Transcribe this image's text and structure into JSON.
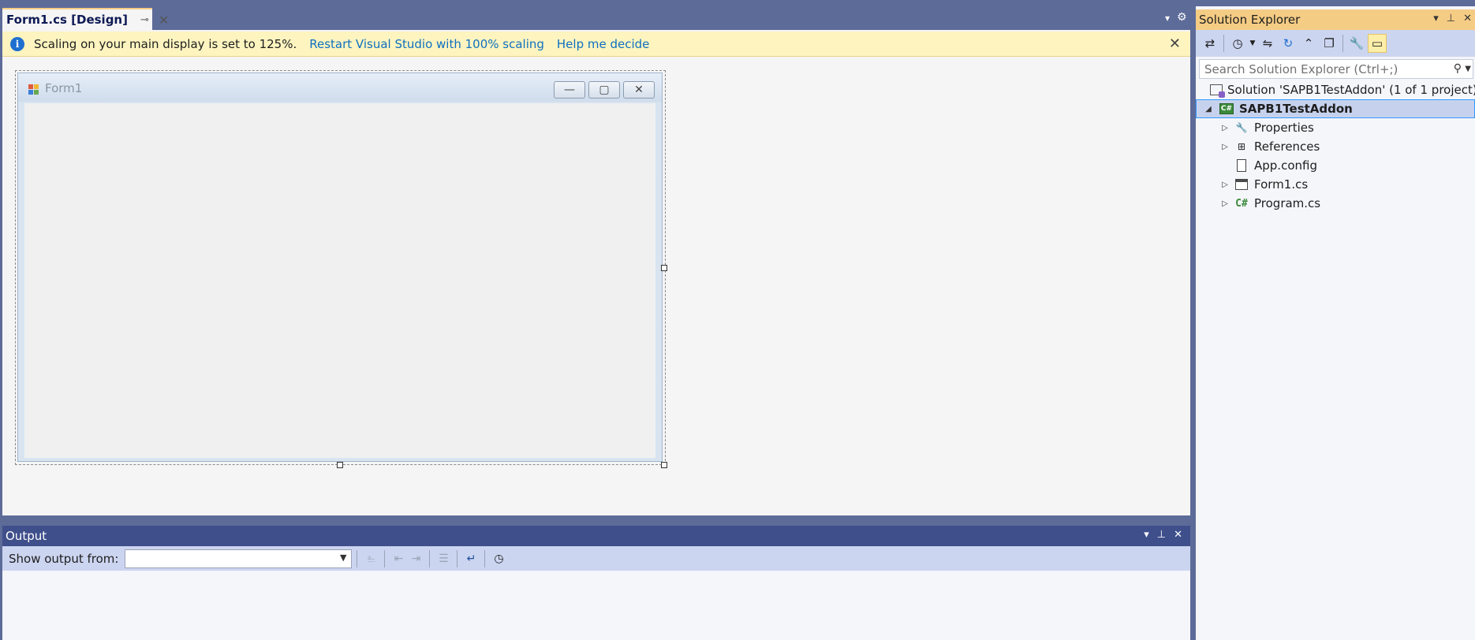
{
  "document": {
    "tab_title": "Form1.cs [Design]",
    "tab_pin_glyph": "⊸",
    "tab_close_glyph": "✕",
    "strip_dropdown_glyph": "▾",
    "strip_settings_glyph": "⚙"
  },
  "infobar": {
    "icon": "info-icon",
    "message": "Scaling on your main display is set to 125%.",
    "link_restart": "Restart Visual Studio with 100% scaling",
    "link_help": "Help me decide",
    "close_glyph": "✕"
  },
  "designer_form": {
    "title": "Form1",
    "minimize_glyph": "—",
    "maximize_glyph": "▢",
    "close_glyph": "✕"
  },
  "output": {
    "title": "Output",
    "show_output_from_label": "Show output from:",
    "selected_source": "",
    "header_icons": [
      "dropdown-icon",
      "pin-icon",
      "close-icon"
    ]
  },
  "solution_explorer": {
    "title": "Solution Explorer",
    "search_placeholder": "Search Solution Explorer (Ctrl+;)",
    "toolbar_icons": [
      "switch-views-icon",
      "pending-changes-icon",
      "sync-icon",
      "refresh-icon",
      "collapse-all-icon",
      "show-all-files-icon",
      "properties-icon",
      "preview-selected-icon"
    ],
    "tree": {
      "solution": "Solution 'SAPB1TestAddon' (1 of 1 project)",
      "project": "SAPB1TestAddon",
      "items": [
        {
          "label": "Properties",
          "expandable": true,
          "icon": "wrench-icon"
        },
        {
          "label": "References",
          "expandable": true,
          "icon": "references-icon"
        },
        {
          "label": "App.config",
          "expandable": false,
          "icon": "config-file-icon"
        },
        {
          "label": "Form1.cs",
          "expandable": true,
          "icon": "form-icon"
        },
        {
          "label": "Program.cs",
          "expandable": true,
          "icon": "csharp-file-icon"
        }
      ]
    }
  },
  "colors": {
    "chrome": "#5d6b99",
    "active_panel_header": "#f5cc84",
    "infobar_bg": "#fdf4bf",
    "link": "#0e70c0",
    "selection": "#c6d2ed"
  }
}
